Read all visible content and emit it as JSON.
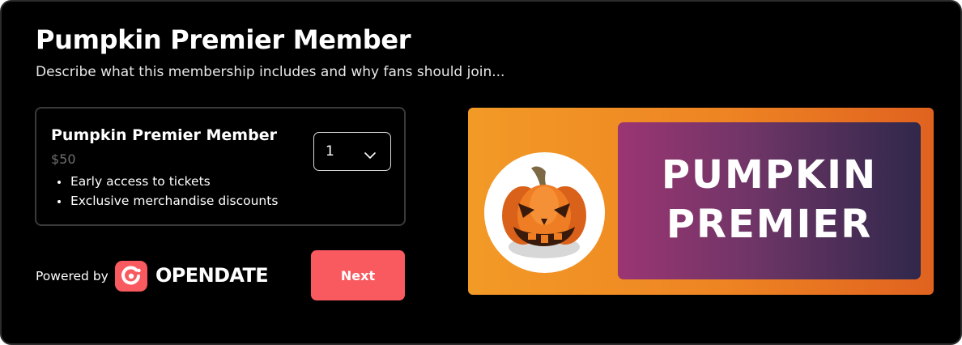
{
  "membership": {
    "title": "Pumpkin Premier Member",
    "description": "Describe what this membership includes and why fans should join..."
  },
  "tier": {
    "name": "Pumpkin Premier Member",
    "price": "$50",
    "perks": [
      "Early access to tickets",
      "Exclusive merchandise discounts"
    ],
    "quantity": "1"
  },
  "footer": {
    "powered_by": "Powered by",
    "brand": "OPENDATE",
    "next_label": "Next"
  },
  "banner": {
    "line1": "PUMPKIN",
    "line2": "PREMIER"
  },
  "icons": {
    "quantity_chevron": "chevron-down-icon",
    "brand_logo": "opendate-logo-icon",
    "banner_image": "jack-o-lantern-icon"
  },
  "colors": {
    "background": "#000000",
    "accent": "#f95a5f",
    "banner_orange": "#ee8423",
    "banner_purple": "#9b3573",
    "banner_navy": "#30284b"
  }
}
